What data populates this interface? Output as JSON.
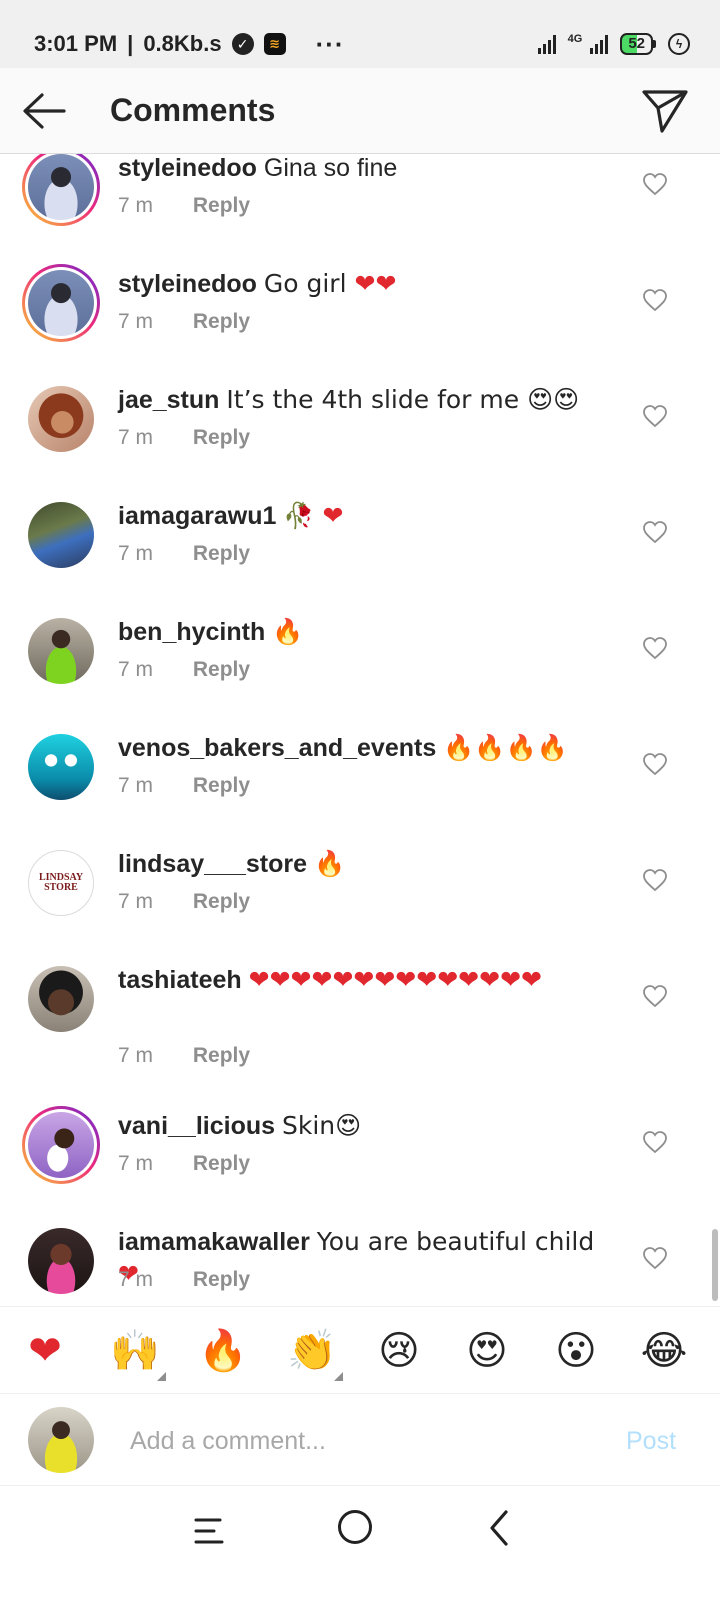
{
  "status_bar": {
    "time": "3:01 PM",
    "speed": "0.8Kb.s",
    "more": "···",
    "network": "4G",
    "battery": "52",
    "icons": [
      "check-circle-icon",
      "audiomack-icon",
      "signal-icon",
      "charging-icon"
    ]
  },
  "header": {
    "title": "Comments",
    "back_icon": "arrow-left-icon",
    "share_icon": "paper-plane-icon"
  },
  "comments": [
    {
      "user": "styleinedoo",
      "text": "Gina so fine",
      "time": "7 m",
      "reply": "Reply"
    },
    {
      "user": "styleinedoo",
      "text": "Go girl ❤❤",
      "time": "7 m",
      "reply": "Reply"
    },
    {
      "user": "jae_stun",
      "text": "It’s the 4th slide for me 😍😍",
      "time": "7 m",
      "reply": "Reply"
    },
    {
      "user": "iamagarawu1",
      "text": "🥀 ❤",
      "time": "7 m",
      "reply": "Reply"
    },
    {
      "user": "ben_hycinth",
      "text": "🔥",
      "time": "7 m",
      "reply": "Reply"
    },
    {
      "user": "venos_bakers_and_events",
      "text": "🔥🔥🔥🔥",
      "time": "7 m",
      "reply": "Reply"
    },
    {
      "user": "lindsay___store",
      "text": "🔥",
      "time": "7 m",
      "reply": "Reply",
      "avatar_text": "LINDSAY STORE"
    },
    {
      "user": "tashiateeh",
      "text": "❤❤❤❤❤❤❤❤❤❤❤❤❤❤",
      "time": "7 m",
      "reply": "Reply"
    },
    {
      "user": "vani__licious",
      "text": "Skin😍",
      "time": "7 m",
      "reply": "Reply"
    },
    {
      "user": "iamamakawaller",
      "text": "You are beautiful child ❤",
      "time": "7 m",
      "reply": "Reply"
    }
  ],
  "emoji_bar": [
    "❤",
    "🙌",
    "🔥",
    "👏",
    "😢",
    "😍",
    "😮",
    "😂"
  ],
  "compose": {
    "placeholder": "Add a comment...",
    "post_label": "Post"
  },
  "nav": {
    "icons": [
      "menu-icon",
      "home-circle-icon",
      "back-chevron-icon"
    ]
  },
  "colors": {
    "text": "#262626",
    "secondary": "#8e8e8e",
    "post_disabled": "#b2dffc",
    "heart": "#e0282e"
  }
}
